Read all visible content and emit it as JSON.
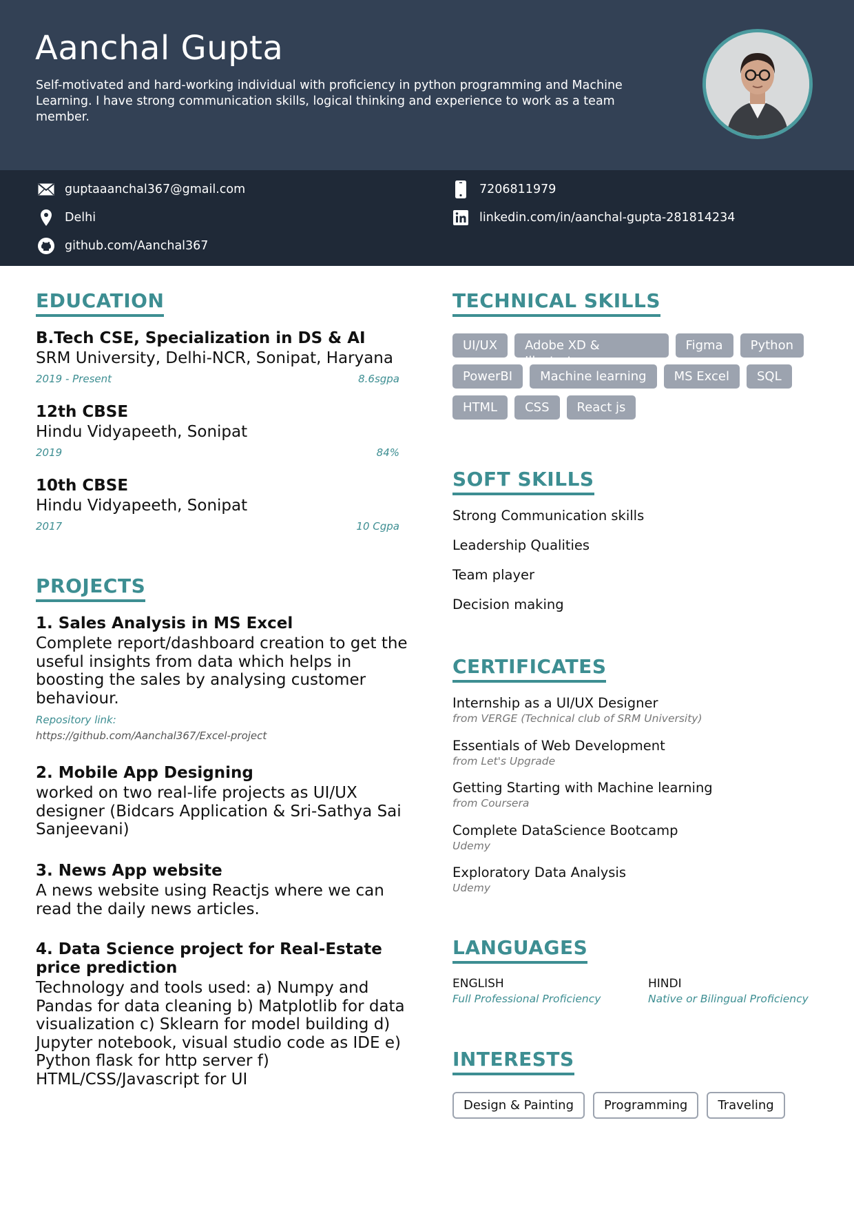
{
  "header": {
    "name": "Aanchal Gupta",
    "summary": "Self-motivated and hard-working individual with proficiency in python programming and Machine Learning. I have strong communication skills, logical thinking and experience to work as a team member."
  },
  "contact": {
    "email": "guptaaanchal367@gmail.com",
    "location": "Delhi",
    "github": "github.com/Aanchal367",
    "phone": "7206811979",
    "linkedin": "linkedin.com/in/aanchal-gupta-281814234"
  },
  "education": {
    "title": "EDUCATION",
    "items": [
      {
        "degree": "B.Tech CSE, Specialization in DS & AI",
        "school": "SRM University, Delhi-NCR, Sonipat, Haryana",
        "date": "2019 - Present",
        "score": "8.6sgpa"
      },
      {
        "degree": "12th CBSE",
        "school": "Hindu Vidyapeeth, Sonipat",
        "date": "2019",
        "score": "84%"
      },
      {
        "degree": "10th CBSE",
        "school": "Hindu Vidyapeeth, Sonipat",
        "date": "2017",
        "score": "10 Cgpa"
      }
    ]
  },
  "projects": {
    "title": "PROJECTS",
    "items": [
      {
        "title": "1. Sales Analysis in MS Excel",
        "desc": "Complete report/dashboard creation to get the useful insights from data which helps in boosting the sales by analysing customer behaviour.",
        "repo_label": "Repository link:",
        "repo": "https://github.com/Aanchal367/Excel-project"
      },
      {
        "title": "2. Mobile App Designing",
        "desc": "worked on two real-life projects as UI/UX designer (Bidcars Application & Sri-Sathya Sai Sanjeevani)"
      },
      {
        "title": "3. News App website",
        "desc": "A news website using Reactjs where we can read the daily news articles."
      },
      {
        "title": "4. Data Science project for Real-Estate price prediction",
        "desc": "Technology and tools used: a) Numpy and Pandas for data cleaning b) Matplotlib for data visualization c) Sklearn for model building d) Jupyter notebook, visual studio code as IDE e) Python flask for http server f) HTML/CSS/Javascript for UI"
      }
    ]
  },
  "technical_skills": {
    "title": "TECHNICAL SKILLS",
    "rows": [
      [
        "UI/UX",
        "Adobe XD & Illustrator",
        "Figma",
        "Python"
      ],
      [
        "PowerBI",
        "Machine learning",
        "MS Excel",
        "SQL"
      ],
      [
        "HTML",
        "CSS",
        "React js"
      ]
    ]
  },
  "soft_skills": {
    "title": "SOFT SKILLS",
    "items": [
      "Strong Communication skills",
      "Leadership Qualities",
      "Team player",
      "Decision making"
    ]
  },
  "certificates": {
    "title": "CERTIFICATES",
    "items": [
      {
        "name": "Internship as a UI/UX Designer",
        "from": "from VERGE (Technical club of SRM University)"
      },
      {
        "name": "Essentials of Web Development",
        "from": "from Let's Upgrade"
      },
      {
        "name": "Getting Starting with Machine learning",
        "from": "from Coursera"
      },
      {
        "name": "Complete DataScience Bootcamp",
        "from": "Udemy"
      },
      {
        "name": "Exploratory Data Analysis",
        "from": "Udemy"
      }
    ]
  },
  "languages": {
    "title": "LANGUAGES",
    "items": [
      {
        "name": "ENGLISH",
        "level": "Full Professional Proficiency"
      },
      {
        "name": "HINDI",
        "level": "Native or Bilingual Proficiency"
      }
    ]
  },
  "interests": {
    "title": "INTERESTS",
    "items": [
      "Design & Painting",
      "Programming",
      "Traveling"
    ]
  },
  "colors": {
    "header_bg": "#334155",
    "contact_bg": "#1f2937",
    "accent": "#3d8e92",
    "chip_bg": "#9ca3af"
  }
}
